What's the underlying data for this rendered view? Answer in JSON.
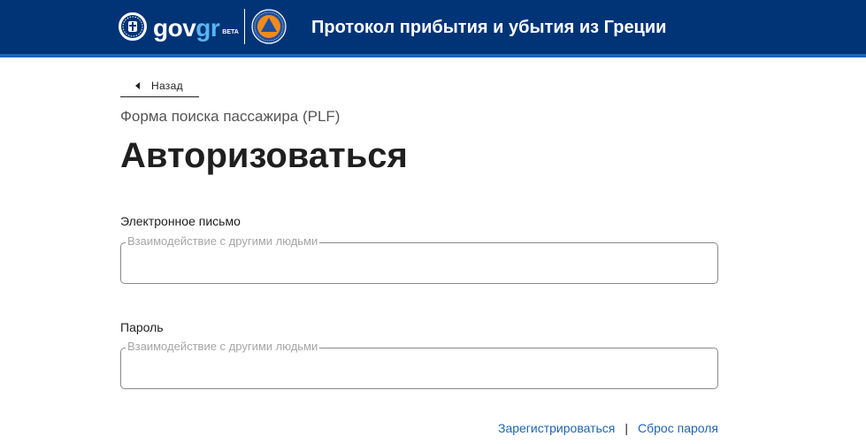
{
  "header": {
    "brand_gov": "gov",
    "brand_gr": "gr",
    "brand_beta": "BETA",
    "app_title": "Протокол прибытия и убытия из Греции",
    "colors": {
      "bar": "#003476",
      "bar_accent": "#1e64b4",
      "brand_gr": "#5ab4f0"
    },
    "icons": [
      "greek-seal-icon",
      "civil-protection-logo-icon"
    ]
  },
  "nav": {
    "back_label": "Назад"
  },
  "main": {
    "subtitle": "Форма поиска пассажира (PLF)",
    "title": "Авторизоваться",
    "email": {
      "label": "Электронное письмо",
      "legend": "Взаимодействие с другими людьми",
      "value": ""
    },
    "password": {
      "label": "Пароль",
      "legend": "Взаимодействие с другими людьми",
      "value": ""
    }
  },
  "links": {
    "register": "Зарегистрироваться",
    "separator": "|",
    "reset_password": "Сброс пароля",
    "color": "#1e64b4"
  }
}
